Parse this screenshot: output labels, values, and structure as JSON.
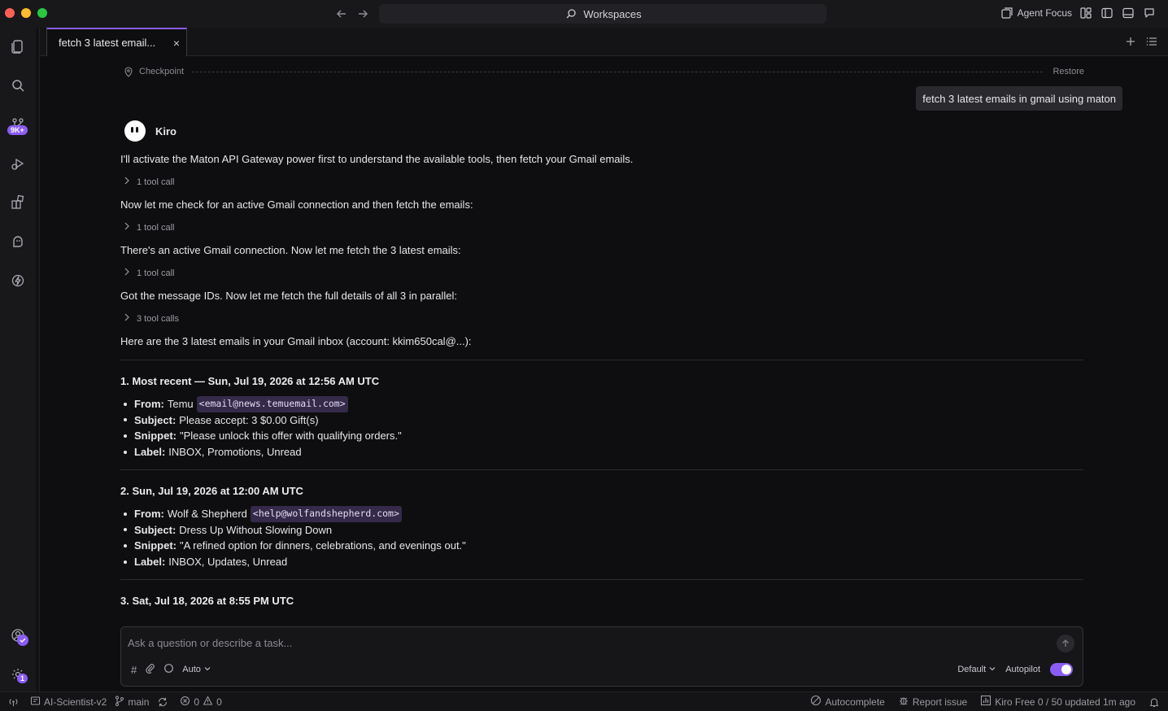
{
  "window": {
    "search_label": "Workspaces",
    "agent_focus_label": "Agent Focus"
  },
  "activity": {
    "source_control_badge": "9K+",
    "settings_badge": "1"
  },
  "tab": {
    "title": "fetch 3 latest email...",
    "close": "×"
  },
  "chat": {
    "checkpoint_label": "Checkpoint",
    "restore_label": "Restore",
    "user_message": "fetch 3 latest emails in gmail using maton",
    "agent_name": "Kiro",
    "messages": [
      "I'll activate the Maton API Gateway power first to understand the available tools, then fetch your Gmail emails.",
      "Now let me check for an active Gmail connection and then fetch the emails:",
      "There's an active Gmail connection. Now let me fetch the 3 latest emails:",
      "Got the message IDs. Now let me fetch the full details of all 3 in parallel:",
      "Here are the 3 latest emails in your Gmail inbox (account: kkim650cal@...):"
    ],
    "tool_calls": [
      "1 tool call",
      "1 tool call",
      "1 tool call",
      "3 tool calls"
    ],
    "field_labels": {
      "from": "From:",
      "subject": "Subject:",
      "snippet": "Snippet:",
      "label": "Label:"
    },
    "emails": [
      {
        "heading": "1. Most recent — Sun, Jul 19, 2026 at 12:56 AM UTC",
        "from_name": "Temu",
        "from_email": "<email@news.temuemail.com>",
        "subject": "Please accept: 3 $0.00 Gift(s)",
        "snippet": "\"Please unlock this offer with qualifying orders.\"",
        "label": "INBOX, Promotions, Unread"
      },
      {
        "heading": "2. Sun, Jul 19, 2026 at 12:00 AM UTC",
        "from_name": "Wolf & Shepherd",
        "from_email": "<help@wolfandshepherd.com>",
        "subject": "Dress Up Without Slowing Down",
        "snippet": "\"A refined option for dinners, celebrations, and evenings out.\"",
        "label": "INBOX, Updates, Unread"
      },
      {
        "heading": "3. Sat, Jul 18, 2026 at 8:55 PM UTC"
      }
    ]
  },
  "composer": {
    "placeholder": "Ask a question or describe a task...",
    "model_label": "Auto",
    "mode_label": "Default",
    "autopilot_label": "Autopilot"
  },
  "status": {
    "workspace": "AI-Scientist-v2",
    "branch": "main",
    "errors": "0",
    "warnings": "0",
    "autocomplete": "Autocomplete",
    "report_issue": "Report issue",
    "plan": "Kiro Free 0 / 50 updated 1m ago"
  },
  "colors": {
    "accent": "#8b5cf6",
    "background": "#0e0e10"
  }
}
